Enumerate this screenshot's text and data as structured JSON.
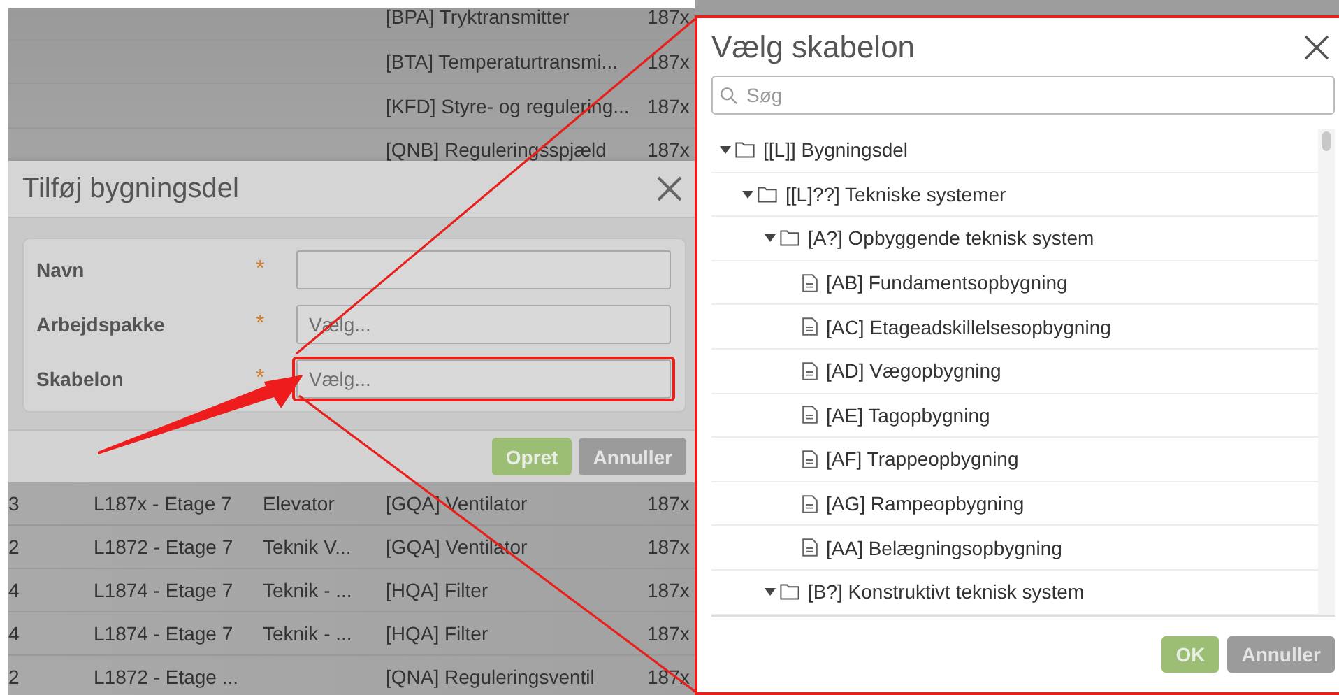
{
  "background_table": {
    "rows_above": [
      {
        "column_4": "[BPA] Tryktransmitter",
        "column_5": "187x"
      },
      {
        "column_4": "[BTA] Temperaturtransmi...",
        "column_5": "187x"
      },
      {
        "column_4": "[KFD] Styre- og regulering...",
        "column_5": "187x"
      },
      {
        "column_4": "[QNB] Reguleringsspjæld",
        "column_5": "187x"
      }
    ],
    "rows_below": [
      {
        "column_1": "3",
        "column_2": "L187x - Etage 7",
        "column_3": "Elevator",
        "column_4": "[GQA] Ventilator",
        "column_5": "187x"
      },
      {
        "column_1": "2",
        "column_2": "L1872 - Etage 7",
        "column_3": "Teknik V...",
        "column_4": "[GQA] Ventilator",
        "column_5": "187x"
      },
      {
        "column_1": "4",
        "column_2": "L1874 - Etage 7",
        "column_3": "Teknik - ...",
        "column_4": "[HQA] Filter",
        "column_5": "187x"
      },
      {
        "column_1": "4",
        "column_2": "L1874 - Etage 7",
        "column_3": "Teknik - ...",
        "column_4": "[HQA] Filter",
        "column_5": "187x"
      },
      {
        "column_1": "2",
        "column_2": "L1872 - Etage ...",
        "column_4": "[QNA] Reguleringsventil",
        "column_5": "187x"
      }
    ]
  },
  "dialog": {
    "title": "Tilføj bygningsdel",
    "fields": [
      {
        "label": "Navn",
        "required_mark": "*",
        "highlighted": false
      },
      {
        "label": "Arbejdspakke",
        "required_mark": "*",
        "placeholder": "Vælg...",
        "highlighted": false
      },
      {
        "label": "Skabelon",
        "required_mark": "*",
        "placeholder": "Vælg...",
        "highlighted": true
      }
    ],
    "buttons": [
      {
        "label": "Opret",
        "kind": "primary"
      },
      {
        "label": "Annuller",
        "kind": "secondary"
      }
    ]
  },
  "picker": {
    "title": "Vælg skabelon",
    "search": {
      "placeholder": "Søg"
    },
    "tree": [
      {
        "label": "[[L]] Bygningsdel",
        "kind": "folder",
        "expanded": true,
        "children": [
          {
            "label": "[[L]??] Tekniske systemer",
            "kind": "folder",
            "expanded": true,
            "children": [
              {
                "label": "[A?] Opbyggende teknisk system",
                "kind": "folder",
                "expanded": true,
                "children": [
                  {
                    "label": "[AB] Fundamentsopbygning",
                    "kind": "file"
                  },
                  {
                    "label": "[AC] Etageadskillelsesopbygning",
                    "kind": "file"
                  },
                  {
                    "label": "[AD] Vægopbygning",
                    "kind": "file"
                  },
                  {
                    "label": "[AE] Tagopbygning",
                    "kind": "file"
                  },
                  {
                    "label": "[AF] Trappeopbygning",
                    "kind": "file"
                  },
                  {
                    "label": "[AG] Rampeopbygning",
                    "kind": "file"
                  },
                  {
                    "label": "[AA] Belægningsopbygning",
                    "kind": "file"
                  }
                ]
              },
              {
                "label": "[B?] Konstruktivt teknisk system",
                "kind": "folder",
                "expanded": true
              }
            ]
          }
        ]
      }
    ],
    "buttons": [
      {
        "label": "OK",
        "kind": "primary"
      },
      {
        "label": "Annuller",
        "kind": "secondary"
      }
    ]
  }
}
